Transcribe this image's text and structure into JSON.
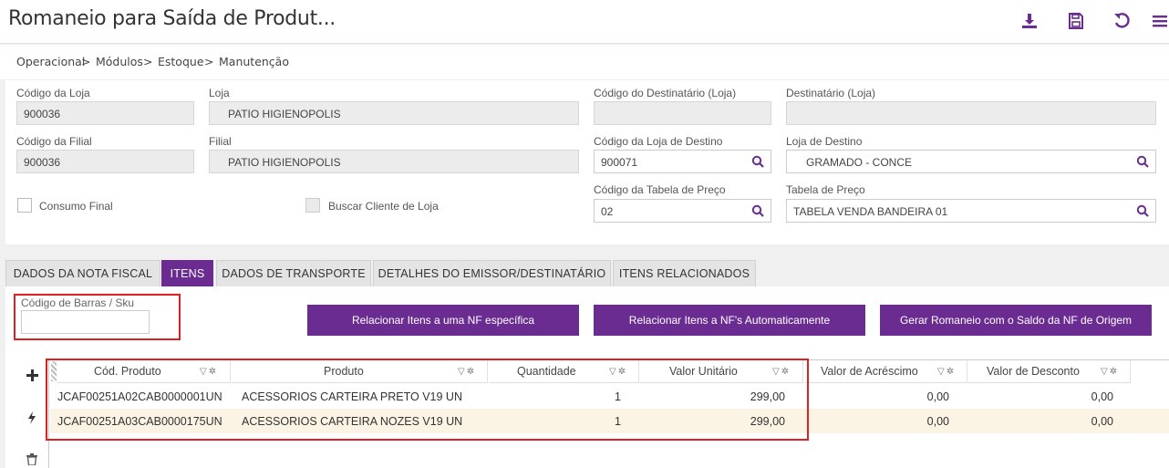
{
  "header": {
    "title": "Romaneio para Saída de Produt...",
    "icons": [
      "download-icon",
      "save-icon",
      "refresh-icon",
      "menu-icon"
    ]
  },
  "breadcrumb": [
    "Operacional",
    "Módulos",
    "Estoque",
    "Manutenção"
  ],
  "breadcrumb_sep": ">",
  "form": {
    "codigo_loja_label": "Código da Loja",
    "codigo_loja_value": "900036",
    "loja_label": "Loja",
    "loja_value": "PATIO HIGIENOPOLIS",
    "codigo_destinatario_label": "Código do Destinatário (Loja)",
    "codigo_destinatario_value": "",
    "destinatario_label": "Destinatário (Loja)",
    "destinatario_value": "",
    "codigo_filial_label": "Código da Filial",
    "codigo_filial_value": "900036",
    "filial_label": "Filial",
    "filial_value": "PATIO HIGIENOPOLIS",
    "codigo_loja_destino_label": "Código da Loja de Destino",
    "codigo_loja_destino_value": "900071",
    "loja_destino_label": "Loja de Destino",
    "loja_destino_value": "GRAMADO - CONCE",
    "consumo_final_label": "Consumo Final",
    "buscar_cliente_label": "Buscar Cliente de Loja",
    "codigo_tabela_preco_label": "Código da Tabela de Preço",
    "codigo_tabela_preco_value": "02",
    "tabela_preco_label": "Tabela de Preço",
    "tabela_preco_value": "TABELA VENDA BANDEIRA 01"
  },
  "tabs": [
    {
      "label": "DADOS DA NOTA FISCAL"
    },
    {
      "label": "ITENS"
    },
    {
      "label": "DADOS DE TRANSPORTE"
    },
    {
      "label": "DETALHES DO EMISSOR/DESTINATÁRIO"
    },
    {
      "label": "ITENS RELACIONADOS"
    }
  ],
  "active_tab": "ITENS",
  "items": {
    "barcode_label": "Código de Barras / Sku",
    "barcode_value": "",
    "buttons": [
      {
        "label": "Relacionar Itens a uma NF específica"
      },
      {
        "label": "Relacionar Itens a NF's Automaticamente"
      },
      {
        "label": "Gerar Romaneio com o Saldo da NF de Origem"
      }
    ]
  },
  "grid": {
    "columns": [
      "Cód. Produto",
      "Produto",
      "Quantidade",
      "Valor Unitário",
      "Valor de Acréscimo",
      "Valor de Desconto"
    ],
    "rows": [
      {
        "codigo": "JCAF00251A02CAB0000001UN",
        "produto": "ACESSORIOS CARTEIRA PRETO V19 UN",
        "quantidade": "1",
        "valor_unitario": "299,00",
        "acrescimo": "0,00",
        "desconto": "0,00"
      },
      {
        "codigo": "JCAF00251A03CAB0000175UN",
        "produto": "ACESSORIOS CARTEIRA NOZES V19 UN",
        "quantidade": "1",
        "valor_unitario": "299,00",
        "acrescimo": "0,00",
        "desconto": "0,00"
      }
    ]
  },
  "colors": {
    "accent": "#6b2c91",
    "highlight": "#e02020",
    "alt_row": "#fbf3e4"
  }
}
